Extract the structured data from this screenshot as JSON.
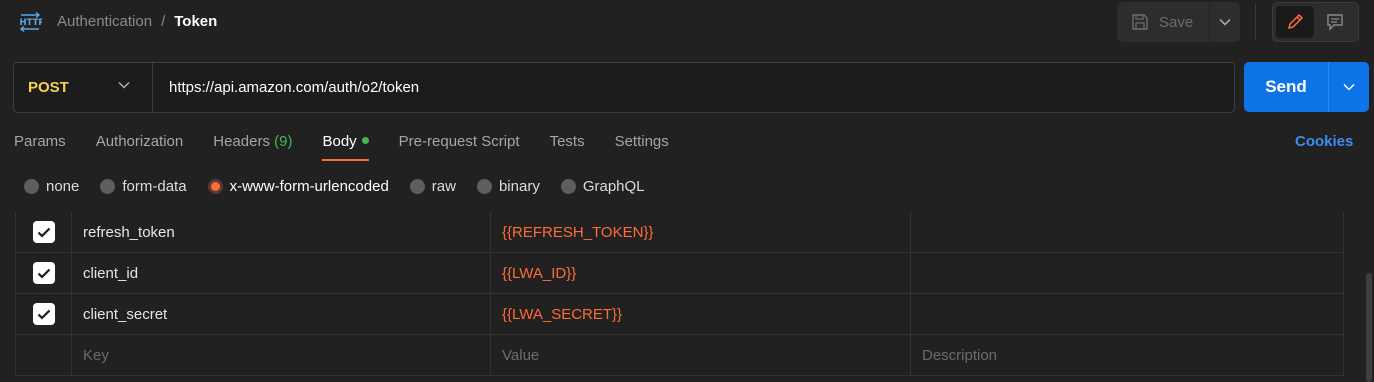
{
  "header": {
    "breadcrumb_parent": "Authentication",
    "breadcrumb_separator": "/",
    "breadcrumb_current": "Token",
    "save_label": "Save",
    "http_icon": "http-icon"
  },
  "request": {
    "method": "POST",
    "url": "https://api.amazon.com/auth/o2/token",
    "send_label": "Send"
  },
  "tabs": [
    {
      "label": "Params"
    },
    {
      "label": "Authorization"
    },
    {
      "label": "Headers",
      "count": "(9)"
    },
    {
      "label": "Body",
      "active": true
    },
    {
      "label": "Pre-request Script"
    },
    {
      "label": "Tests"
    },
    {
      "label": "Settings"
    }
  ],
  "cookies_label": "Cookies",
  "body_types": [
    {
      "label": "none"
    },
    {
      "label": "form-data"
    },
    {
      "label": "x-www-form-urlencoded",
      "selected": true
    },
    {
      "label": "raw"
    },
    {
      "label": "binary"
    },
    {
      "label": "GraphQL"
    }
  ],
  "params": [
    {
      "checked": true,
      "key": "refresh_token",
      "value": "{{REFRESH_TOKEN}}",
      "description": ""
    },
    {
      "checked": true,
      "key": "client_id",
      "value": "{{LWA_ID}}",
      "description": ""
    },
    {
      "checked": true,
      "key": "client_secret",
      "value": "{{LWA_SECRET}}",
      "description": ""
    }
  ],
  "placeholder_row": {
    "key": "Key",
    "value": "Value",
    "description": "Description"
  },
  "colors": {
    "accent": "#ff6c37",
    "send": "#0f73e8",
    "method": "#f7d24a",
    "success": "#3fb950",
    "link": "#3d8ef0"
  }
}
